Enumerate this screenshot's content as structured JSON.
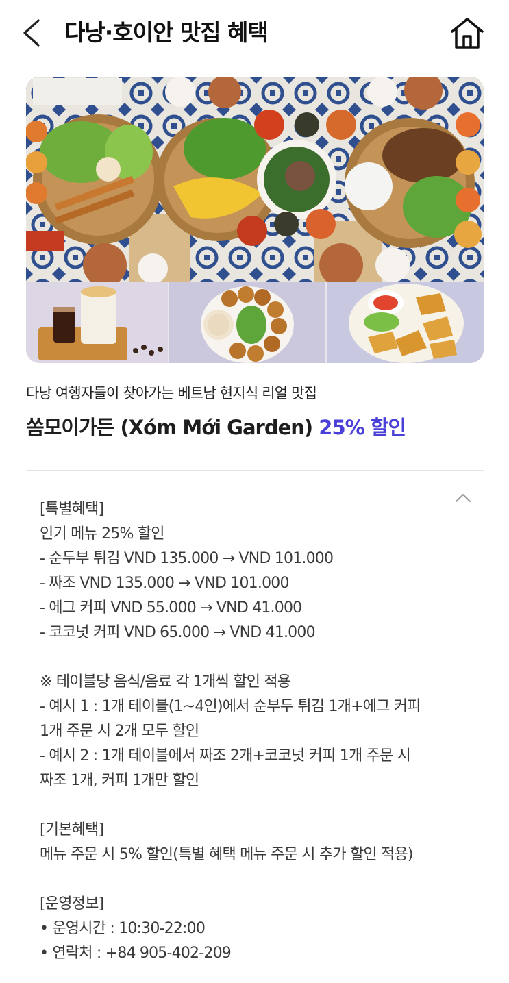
{
  "header": {
    "title": "다낭·호이안 맛집 혜택",
    "back_icon": "chevron-left-icon",
    "home_icon": "home-icon"
  },
  "hero": {
    "subtitle": "다낭 여행자들이 찾아가는 베트남 현지식 리얼 맛집",
    "name": "쏨모이가든 (Xóm Mới Garden)",
    "discount": "25% 할인",
    "accent_color": "#4a3fd6"
  },
  "details": {
    "toggle_icon": "chevron-up-icon",
    "special": {
      "heading": "[특별혜택]",
      "intro": "인기 메뉴 25% 할인",
      "items": [
        "- 순두부 튀김 VND 135.000 → VND 101.000",
        "- 짜조 VND 135.000 → VND 101.000",
        "- 에그 커피 VND 55.000 → VND 41.000",
        "- 코코넛 커피 VND 65.000 → VND 41.000"
      ]
    },
    "notice": {
      "heading": "※ 테이블당 음식/음료 각 1개씩 할인 적용",
      "lines": [
        "- 예시 1 : 1개 테이블(1~4인)에서 순부두 튀김 1개+에그 커피",
        "1개 주문 시 2개 모두 할인",
        "- 예시 2 : 1개 테이블에서 짜조 2개+코코넛 커피 1개 주문 시",
        "짜조 1개, 커피 1개만 할인"
      ]
    },
    "basic": {
      "heading": "[기본혜택]",
      "text": "메뉴 주문 시 5% 할인(특별 혜택 메뉴 주문 시 추가 할인 적용)"
    },
    "info": {
      "heading": "[운영정보]",
      "hours": "• 운영시간 : 10:30-22:00",
      "contact": "• 연락처 : +84 905-402-209"
    }
  }
}
